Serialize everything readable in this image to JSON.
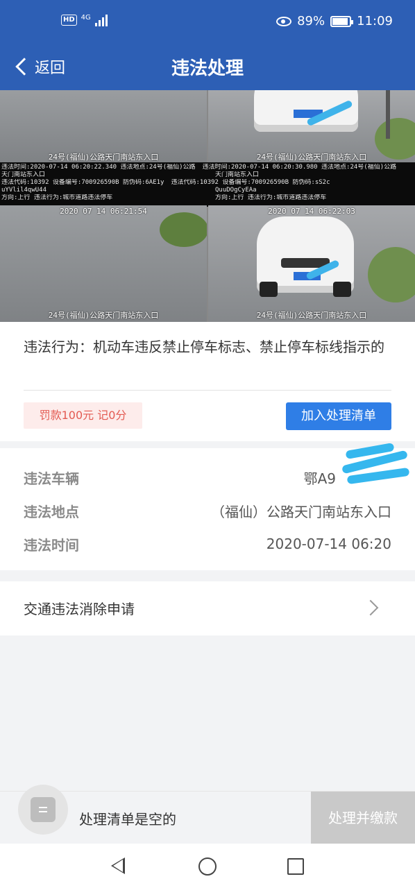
{
  "status_bar": {
    "network": "HD",
    "network_type": "4G",
    "battery": "89%",
    "time": "11:09"
  },
  "header": {
    "back_label": "返回",
    "title": "违法处理"
  },
  "photo": {
    "caption_location": "24号(福仙)公路天门南站东入口",
    "info_line1_a": "违法时间:2020-07-14 06:20:22.340   违法地点:24号(福仙)公路",
    "info_line1_b": "违法时间:2020-07-14 06:20:30.980   违法地点:24号(福仙)公路",
    "info_line2": "天门南站东入口",
    "info_line3_a": "违法代码:10392       设备编号:700926590B   防伪码:6AE1y",
    "info_line3_b": "违法代码:10392       设备编号:700926590B   防伪码:sS2c",
    "info_line4_a": "uYVlil4qwU44",
    "info_line4_b": "QuuDOgCyEAa",
    "info_line5_a": "方向:上行     违法行为:城市道路违法停车",
    "info_line5_b": "方向:上行     违法行为:城市道路违法停车",
    "stamp_c": "2020 07 14  06:21:54",
    "stamp_d": "2020 07 14  06:22:03"
  },
  "violation": {
    "behavior": "违法行为：机动车违反禁止停车标志、禁止停车标线指示的",
    "fine": "罚款100元 记0分",
    "add_button": "加入处理清单"
  },
  "details": {
    "rows": [
      {
        "label": "违法车辆",
        "value": "鄂A9"
      },
      {
        "label": "违法地点",
        "value": "（福仙）公路天门南站东入口"
      },
      {
        "label": "违法时间",
        "value": "2020-07-14 06:20"
      }
    ]
  },
  "appeal": {
    "label": "交通违法消除申请"
  },
  "bottom_bar": {
    "empty_text": "处理清单是空的",
    "pay_button": "处理并缴款"
  },
  "colors": {
    "header_bg": "#2d5fb5",
    "primary_button": "#2f7ee6",
    "fine_text": "#e35a52",
    "fine_bg": "#fdeceb"
  }
}
